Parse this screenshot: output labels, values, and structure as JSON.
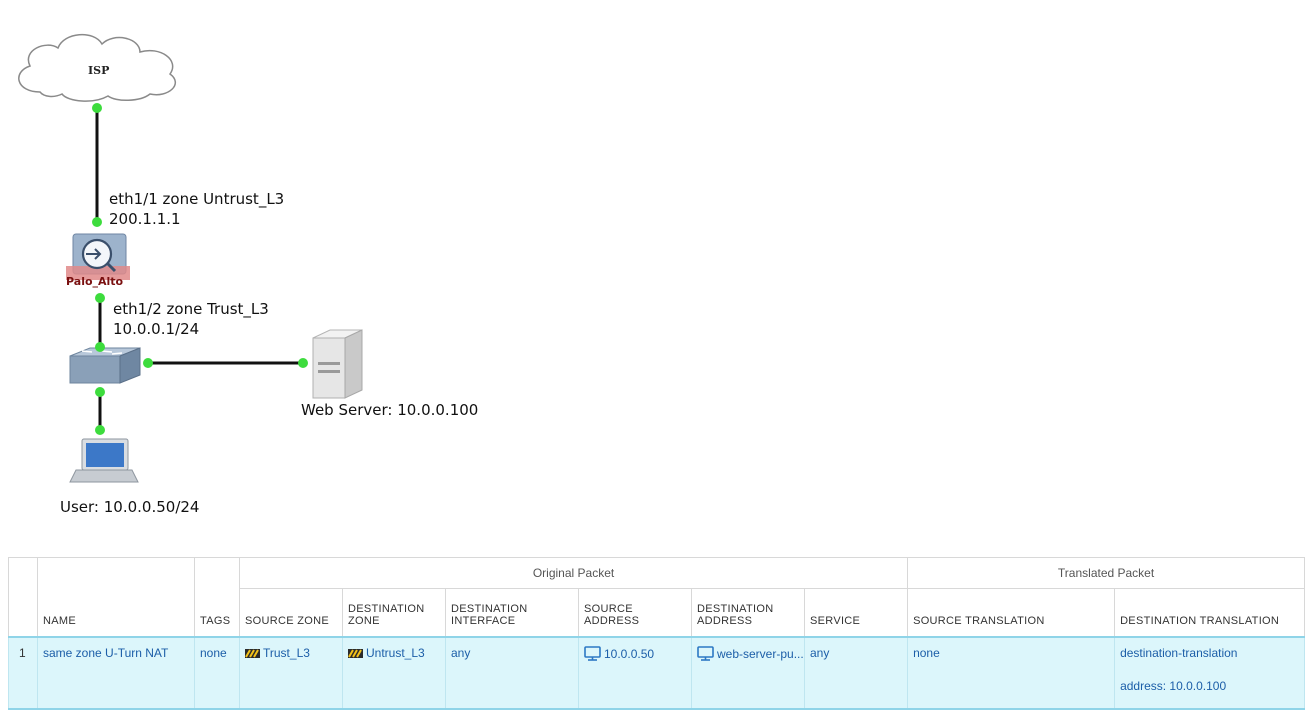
{
  "topology": {
    "isp_label": "ISP",
    "firewall_label": "Palo_Alto",
    "eth1_line1": "eth1/1 zone Untrust_L3",
    "eth1_line2": "200.1.1.1",
    "eth2_line1": "eth1/2 zone Trust_L3",
    "eth2_line2": "10.0.0.1/24",
    "web_server_label": "Web Server: 10.0.0.100",
    "user_label": "User: 10.0.0.50/24"
  },
  "colors": {
    "link_dot": "#3ddc3d",
    "link_line": "#111111",
    "row_highlight": "#dcf6fb",
    "link_text": "#1c5ea8"
  },
  "nat_table": {
    "groups": {
      "original": "Original Packet",
      "translated": "Translated Packet"
    },
    "headers": {
      "name": "NAME",
      "tags": "TAGS",
      "source_zone": "SOURCE ZONE",
      "destination_zone_1": "DESTINATION",
      "destination_zone_2": "ZONE",
      "destination_interface_1": "DESTINATION",
      "destination_interface_2": "INTERFACE",
      "source_address": "SOURCE ADDRESS",
      "destination_address_1": "DESTINATION",
      "destination_address_2": "ADDRESS",
      "service": "SERVICE",
      "source_translation": "SOURCE TRANSLATION",
      "destination_translation": "DESTINATION TRANSLATION"
    },
    "rows": [
      {
        "index": "1",
        "name": "same zone U-Turn NAT",
        "tags": "none",
        "source_zone": "Trust_L3",
        "destination_zone": "Untrust_L3",
        "destination_interface": "any",
        "source_address": "10.0.0.50",
        "destination_address": "web-server-pu...",
        "service": "any",
        "source_translation": "none",
        "destination_translation": "destination-translation",
        "destination_translation_address": "address: 10.0.0.100"
      }
    ],
    "icons": {
      "zone": "zone-icon",
      "address": "address-object-icon"
    }
  }
}
